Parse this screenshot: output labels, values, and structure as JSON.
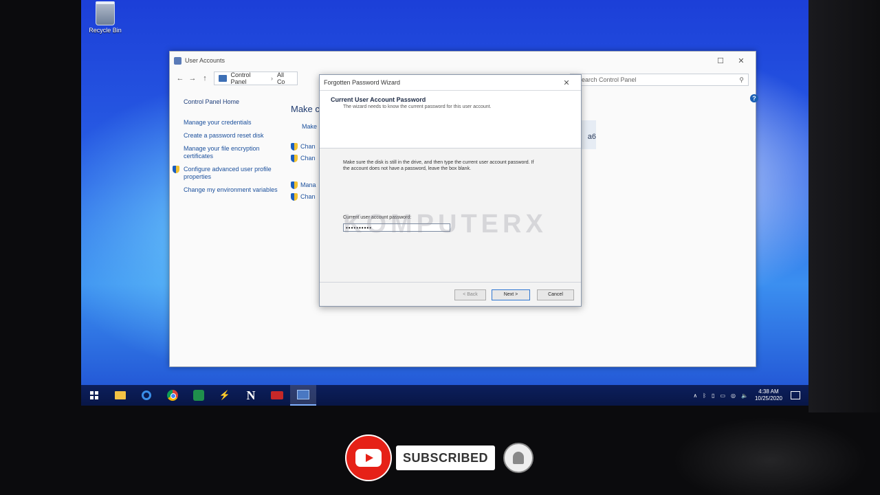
{
  "desktop": {
    "recycle_bin_label": "Recycle Bin"
  },
  "user_accounts_window": {
    "title": "User Accounts",
    "breadcrumb": [
      "Control Panel",
      "All Co"
    ],
    "search_placeholder": "Search Control Panel",
    "sidebar": {
      "home": "Control Panel Home",
      "items": [
        "Manage your credentials",
        "Create a password reset disk",
        "Manage your file encryption certificates",
        "Configure advanced user profile properties",
        "Change my environment variables"
      ]
    },
    "main_heading": "Make c",
    "main_links": [
      "Make",
      "Chan",
      "Chan",
      "Mana",
      "Chan"
    ],
    "account_tile_text": "a6"
  },
  "wizard": {
    "title": "Forgotten Password Wizard",
    "header_title": "Current User Account Password",
    "header_subtitle": "The wizard needs to know the current password for this user account.",
    "instructions": "Make sure the disk is still in the drive, and then type the current user account password. If the account does not have a password, leave the box blank.",
    "field_label": "Current user account password:",
    "password_value": "••••••••••",
    "watermark": "KOMPUTERX",
    "buttons": {
      "back": "< Back",
      "next": "Next >",
      "cancel": "Cancel"
    }
  },
  "taskbar": {
    "apps": [
      "windows-start",
      "file-explorer",
      "edge",
      "chrome",
      "green-app",
      "bolt-app",
      "n-app",
      "recorder-app",
      "user-accounts-app"
    ],
    "clock_time": "4:38 AM",
    "clock_date": "10/25/2020"
  },
  "overlay": {
    "subscribed_label": "SUBSCRIBED"
  },
  "colors": {
    "youtube_red": "#e62117",
    "taskbar": "#0c1f5c",
    "link_blue": "#1a4f9c"
  }
}
